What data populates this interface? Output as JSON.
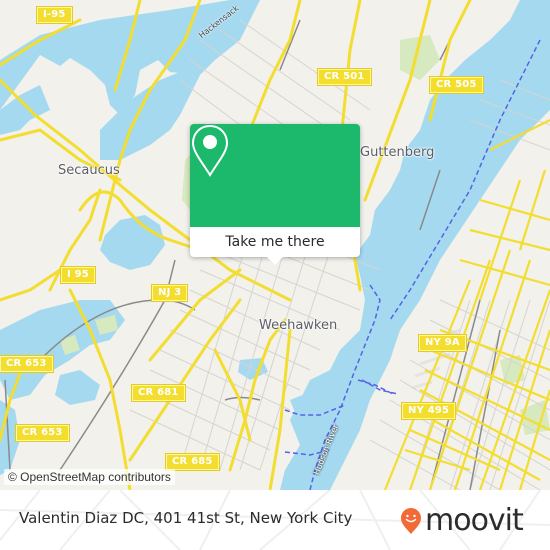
{
  "map": {
    "place_labels": [
      {
        "id": "secaucus",
        "text": "Secaucus"
      },
      {
        "id": "guttenberg",
        "text": "Guttenberg"
      },
      {
        "id": "weehawken",
        "text": "Weehawken"
      }
    ],
    "water_labels": [
      {
        "id": "hackensack",
        "text": "Hackensack"
      },
      {
        "id": "hudson",
        "text": "Hudson River"
      }
    ],
    "road_shields": [
      {
        "id": "i-95-north",
        "text": "I-95"
      },
      {
        "id": "cr-501",
        "text": "CR 501"
      },
      {
        "id": "cr-505",
        "text": "CR 505"
      },
      {
        "id": "i95-south",
        "text": "I 95"
      },
      {
        "id": "nj-3",
        "text": "NJ 3"
      },
      {
        "id": "cr-653-a",
        "text": "CR 653"
      },
      {
        "id": "cr-653-b",
        "text": "CR 653"
      },
      {
        "id": "cr-681",
        "text": "CR 681"
      },
      {
        "id": "cr-685",
        "text": "CR 685"
      },
      {
        "id": "ny-9a",
        "text": "NY 9A"
      },
      {
        "id": "ny-495",
        "text": "NY 495"
      }
    ],
    "attribution": "© OpenStreetMap contributors",
    "colors": {
      "land": "#f2f1ec",
      "water": "#a5d9ef",
      "road": "#f3dd2f",
      "park": "#d7e9bf",
      "ferry": "#5563e6"
    }
  },
  "popup": {
    "icon": "map-pin-icon",
    "button_label": "Take me there",
    "color": "#1cb86b"
  },
  "footer": {
    "title": "Valentin Diaz DC, 401 41st St, New York City",
    "logo_text": "moovit",
    "logo_icon": "moovit-pin-icon",
    "logo_color": "#f26a36"
  }
}
